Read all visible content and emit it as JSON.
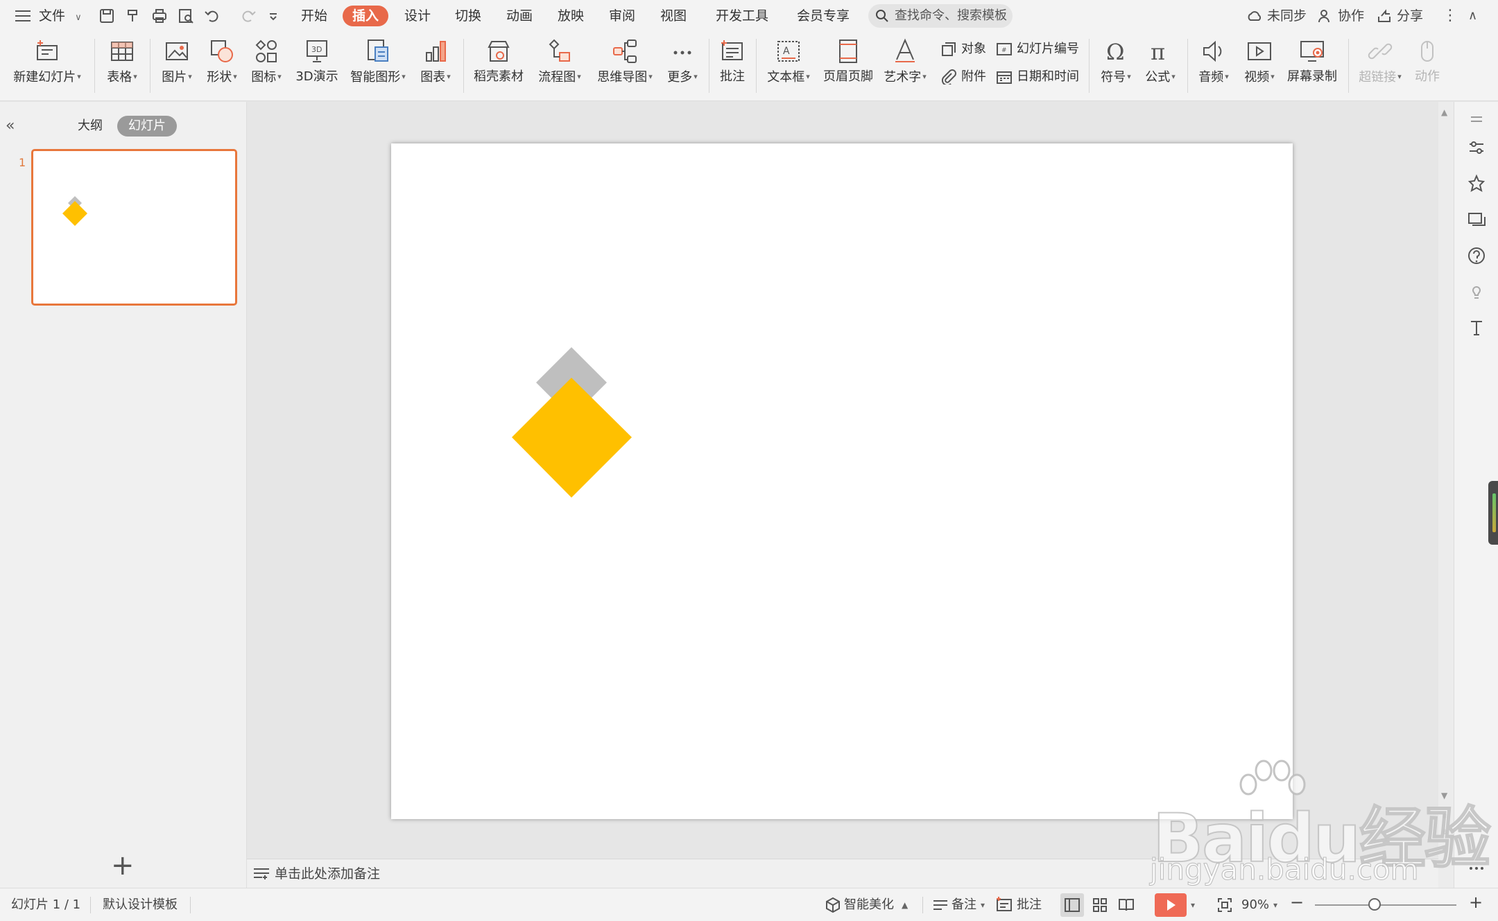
{
  "menubar": {
    "file_label": "文件",
    "tabs": [
      {
        "label": "开始"
      },
      {
        "label": "插入",
        "active": true
      },
      {
        "label": "设计"
      },
      {
        "label": "切换"
      },
      {
        "label": "动画"
      },
      {
        "label": "放映"
      },
      {
        "label": "审阅"
      },
      {
        "label": "视图"
      },
      {
        "label": "开发工具"
      },
      {
        "label": "会员专享"
      }
    ],
    "search_placeholder": "查找命令、搜索模板",
    "sync_label": "未同步",
    "collab_label": "协作",
    "share_label": "分享",
    "accent_color": "#e8694a"
  },
  "ribbon": {
    "new_slide": "新建幻灯片",
    "table": "表格",
    "picture": "图片",
    "shape": "形状",
    "icon": "图标",
    "demo3d": "3D演示",
    "smartart": "智能图形",
    "chart": "图表",
    "docer": "稻壳素材",
    "flowchart": "流程图",
    "mindmap": "思维导图",
    "more": "更多",
    "comment": "批注",
    "textbox": "文本框",
    "header_footer": "页眉页脚",
    "wordart": "艺术字",
    "object": "对象",
    "slide_number": "幻灯片编号",
    "attachment": "附件",
    "date_time": "日期和时间",
    "symbol": "符号",
    "formula": "公式",
    "audio": "音频",
    "video": "视频",
    "screen_record": "屏幕录制",
    "hyperlink": "超链接",
    "action": "动作"
  },
  "leftpanel": {
    "outline_tab": "大纲",
    "slides_tab": "幻灯片",
    "slide_number": "1"
  },
  "slide": {
    "shapes": [
      {
        "type": "diamond",
        "color": "#bfbfbf"
      },
      {
        "type": "diamond",
        "color": "#ffc000"
      }
    ]
  },
  "notes": {
    "placeholder": "单击此处添加备注"
  },
  "statusbar": {
    "slide_position": "幻灯片 1 / 1",
    "template": "默认设计模板",
    "beautify": "智能美化",
    "notes": "备注",
    "comments": "批注",
    "zoom": "90%"
  },
  "watermark": {
    "brand": "Baidu经验",
    "url": "jingyan.baidu.com"
  }
}
